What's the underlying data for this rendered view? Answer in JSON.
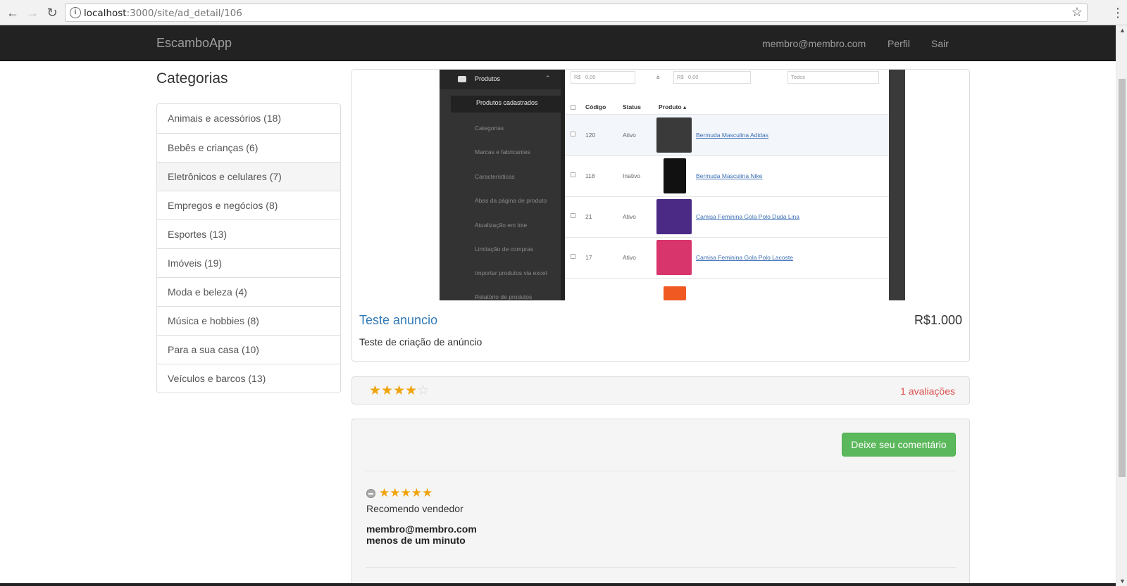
{
  "browser": {
    "url_host": "localhost",
    "url_path": ":3000/site/ad_detail/106"
  },
  "navbar": {
    "brand": "EscamboApp",
    "user_email": "membro@membro.com",
    "profile_label": "Perfil",
    "logout_label": "Sair"
  },
  "sidebar": {
    "title": "Categorias",
    "items": [
      {
        "label": "Animais e acessórios (18)"
      },
      {
        "label": "Bebês e crianças (6)"
      },
      {
        "label": "Eletrônicos e celulares (7)"
      },
      {
        "label": "Empregos e negócios (8)"
      },
      {
        "label": "Esportes (13)"
      },
      {
        "label": "Imóveis (19)"
      },
      {
        "label": "Moda e beleza (4)"
      },
      {
        "label": "Música e hobbies (8)"
      },
      {
        "label": "Para a sua casa (10)"
      },
      {
        "label": "Veículos e barcos (13)"
      }
    ]
  },
  "ad": {
    "title": "Teste anuncio",
    "price": "R$1.000",
    "description": "Teste de criação de anúncio",
    "image": {
      "menu_header": "Produtos",
      "menu_selected": "Produtos cadastrados",
      "menu_items": [
        "Categorias",
        "Marcas e fabricantes",
        "Características",
        "Abas da página de produto",
        "Atualização em lote",
        "Limitação de compras",
        "Importar produtos via excel",
        "Relatório de produtos"
      ],
      "filters": [
        "R$",
        "0,00",
        "à",
        "R$",
        "0,00",
        "Todos"
      ],
      "headers": [
        "Código",
        "Status",
        "Produto ▴"
      ],
      "rows": [
        {
          "code": "120",
          "status": "Ativo",
          "product": "Bermuda Masculina Adidas",
          "color": "#3a3a3a"
        },
        {
          "code": "118",
          "status": "Inativo",
          "product": "Bermuda Masculina Nike",
          "color": "#111111"
        },
        {
          "code": "21",
          "status": "Ativo",
          "product": "Camisa Feminina Gola Polo Duda Lina",
          "color": "#4b2a86"
        },
        {
          "code": "17",
          "status": "Ativo",
          "product": "Camisa Feminina Gola Polo Lacoste",
          "color": "#d7356b"
        }
      ]
    }
  },
  "rating": {
    "stars": 4,
    "max_stars": 5,
    "count_label": "1 avaliações"
  },
  "comments": {
    "button_label": "Deixe seu comentário",
    "items": [
      {
        "stars": 5,
        "text": "Recomendo vendedor",
        "user": "membro@membro.com",
        "time": "menos de um minuto"
      }
    ]
  }
}
